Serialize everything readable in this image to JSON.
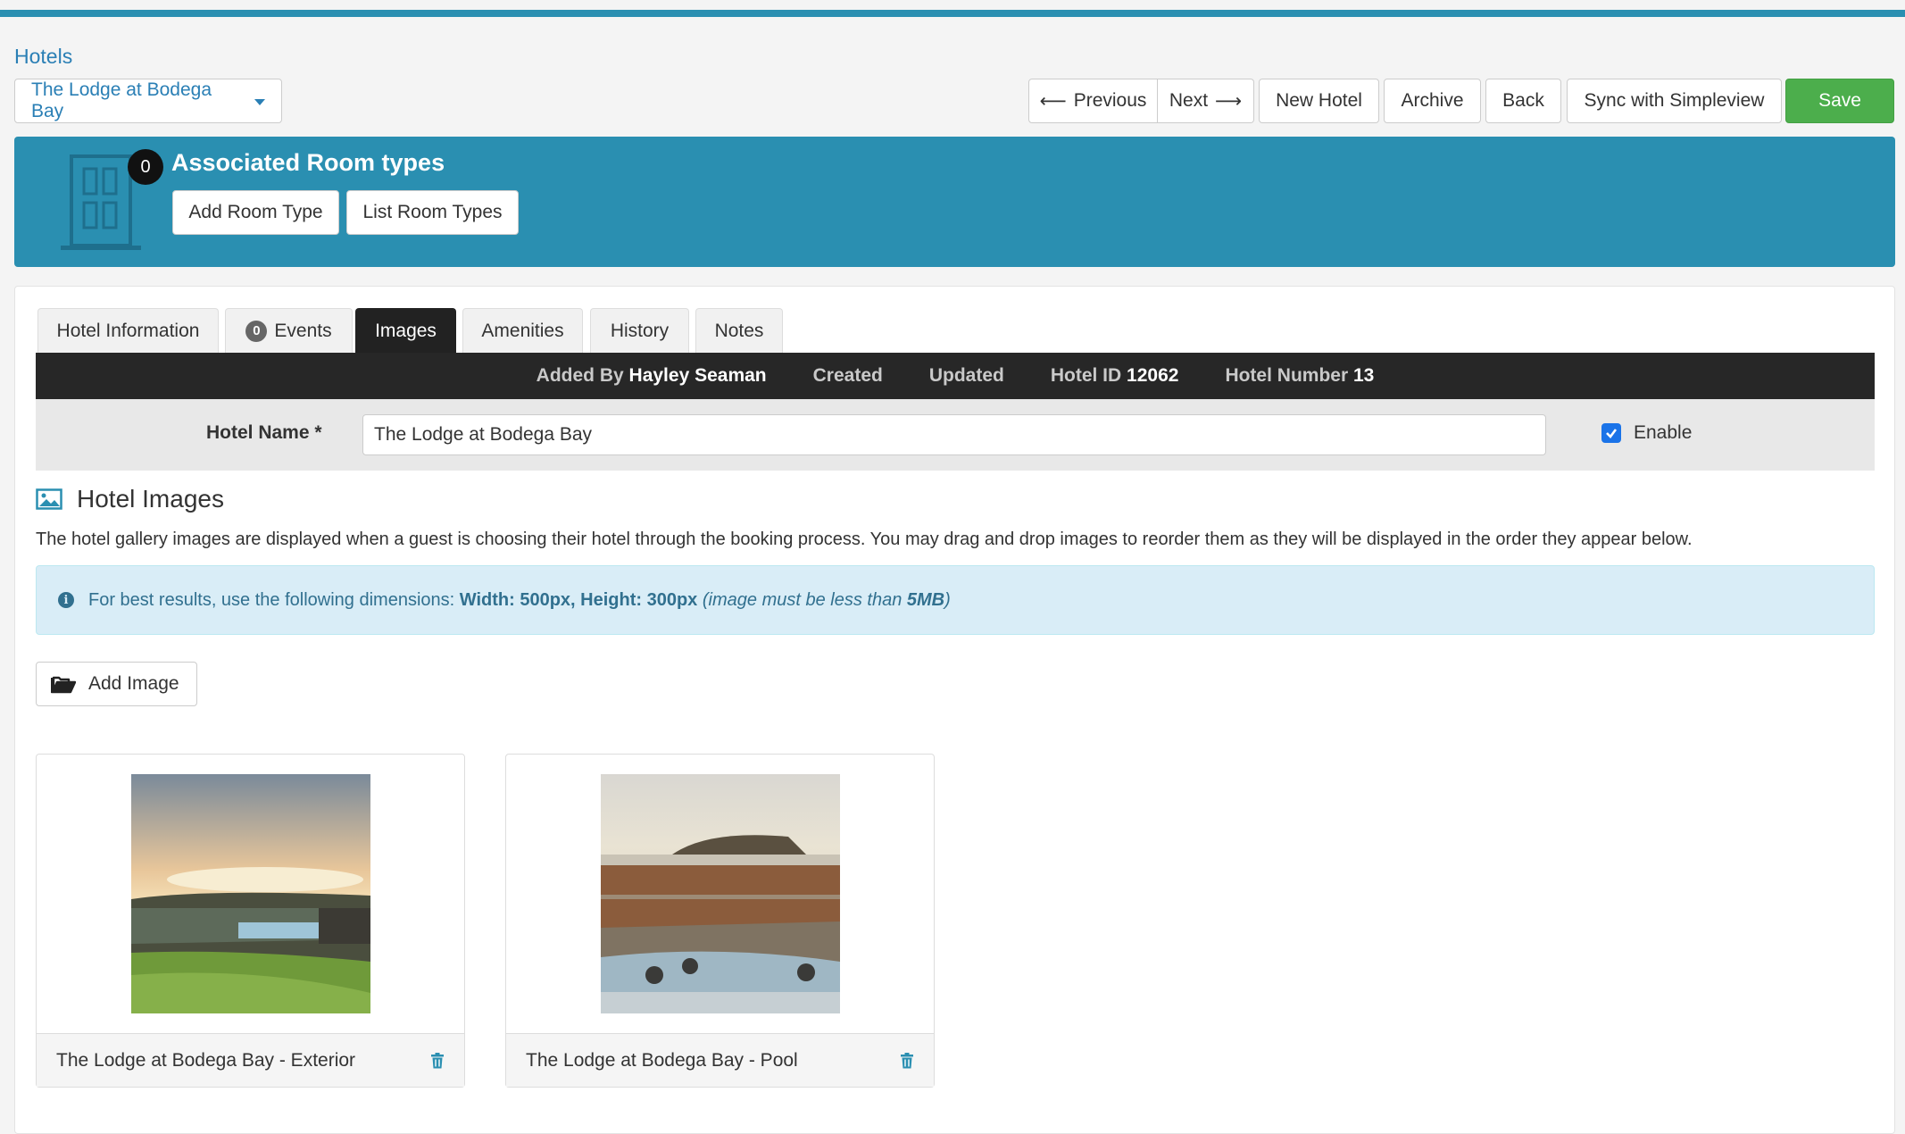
{
  "breadcrumb": "Hotels",
  "hotel_select": "The Lodge at Bodega Bay",
  "toolbar": {
    "previous": "Previous",
    "next": "Next",
    "new_hotel": "New Hotel",
    "archive": "Archive",
    "back": "Back",
    "sync": "Sync with Simpleview",
    "save": "Save"
  },
  "room_types": {
    "count": "0",
    "title": "Associated Room types",
    "add": "Add Room Type",
    "list": "List Room Types"
  },
  "tabs": [
    {
      "label": "Hotel Information"
    },
    {
      "label": "Events",
      "badge": "0"
    },
    {
      "label": "Images"
    },
    {
      "label": "Amenities"
    },
    {
      "label": "History"
    },
    {
      "label": "Notes"
    }
  ],
  "info": {
    "added_by_label": "Added By",
    "added_by": "Hayley Seaman",
    "created_label": "Created",
    "updated_label": "Updated",
    "hotel_id_label": "Hotel ID",
    "hotel_id": "12062",
    "hotel_number_label": "Hotel Number",
    "hotel_number": "13"
  },
  "form": {
    "hotel_name_label": "Hotel Name *",
    "hotel_name": "The Lodge at Bodega Bay",
    "enable_label": "Enable",
    "enabled": true
  },
  "images": {
    "title": "Hotel Images",
    "description": "The hotel gallery images are displayed when a guest is choosing their hotel through the booking process. You may drag and drop images to reorder them as they will be displayed in the order they appear below.",
    "alert_prefix": "For best results, use the following dimensions:",
    "alert_dims": "Width: 500px, Height: 300px",
    "alert_note_pre": "(image must be less than",
    "alert_note_size": "5MB",
    "alert_note_post": ")",
    "add_button": "Add Image",
    "items": [
      {
        "caption": "The Lodge at Bodega Bay - Exterior"
      },
      {
        "caption": "The Lodge at Bodega Bay - Pool"
      }
    ]
  },
  "colors": {
    "accent": "#2a8fb1",
    "save": "#4cae4c",
    "link": "#2a7fb5"
  }
}
